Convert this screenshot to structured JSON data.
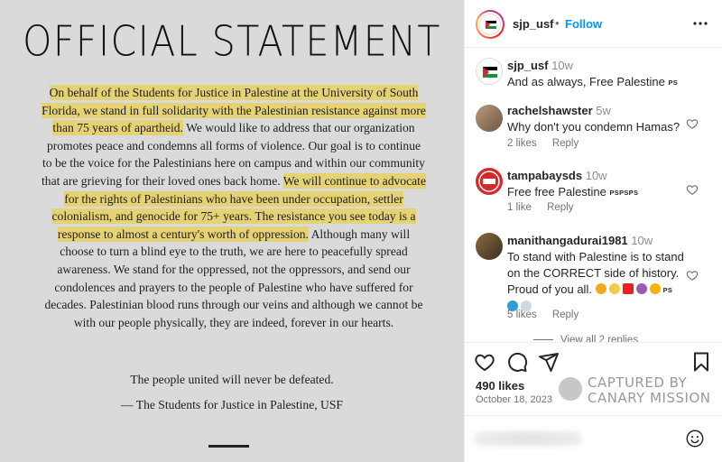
{
  "post_image": {
    "title": "OFFICIAL STATEMENT",
    "segments": [
      {
        "text": "On behalf of the Students for Justice in Palestine at the University of South Florida, we stand in full solidarity with the Palestinian resistance against more than 75 years of apartheid.",
        "highlight": true
      },
      {
        "text": " We would like to address that our organization promotes peace and condemns all forms of violence. Our goal is to continue to be the voice for the Palestinians here on campus and within our community that are grieving for their loved ones back home. ",
        "highlight": false
      },
      {
        "text": "We will continue to advocate for the rights of Palestinians who have been under occupation, settler colonialism, and genocide for 75+ years. The resistance you see today is a response to almost a century's worth of oppression.",
        "highlight": true
      },
      {
        "text": " Although many will choose to turn a blind eye to the truth, we are here to peacefully spread awareness. We stand for the oppressed, not the oppressors, and send our condolences and prayers to the people of Palestine who have suffered for decades. Palestinian blood runs through our veins and although we cannot be with our people physically, they are indeed, forever in our hearts.",
        "highlight": false
      }
    ],
    "closing": "The people united will never be defeated.",
    "signature": "— The Students for Justice in Palestine, USF",
    "highlight_color": "#e5d274"
  },
  "header": {
    "username": "sjp_usf",
    "separator": "•",
    "follow_label": "Follow",
    "follow_color": "#0095f6"
  },
  "comments": [
    {
      "username": "sjp_usf",
      "time": "10w",
      "text": "And as always, Free Palestine",
      "suffix": "PS"
    },
    {
      "username": "rachelshawster",
      "time": "5w",
      "text": "Why don't you condemn Hamas?",
      "likes": "2 likes",
      "reply": "Reply"
    },
    {
      "username": "tampabaysds",
      "time": "10w",
      "text": "Free free Palestine",
      "suffix": "PSPSPS",
      "likes": "1 like",
      "reply": "Reply"
    },
    {
      "username": "manithangadurai1981",
      "time": "10w",
      "text": "To stand with Palestine is to stand on the CORRECT side of history. Proud of you all.",
      "suffix": "PS",
      "likes": "5 likes",
      "reply": "Reply"
    }
  ],
  "view_replies": "View all 2 replies",
  "actions": {
    "likes": "490 likes",
    "date": "October 18, 2023"
  },
  "watermark": {
    "line1": "CAPTURED BY",
    "line2": "CANARY MISSION"
  },
  "icons": [
    "more-icon",
    "heart-icon",
    "comment-icon",
    "share-icon",
    "bookmark-icon",
    "emoji-icon"
  ]
}
